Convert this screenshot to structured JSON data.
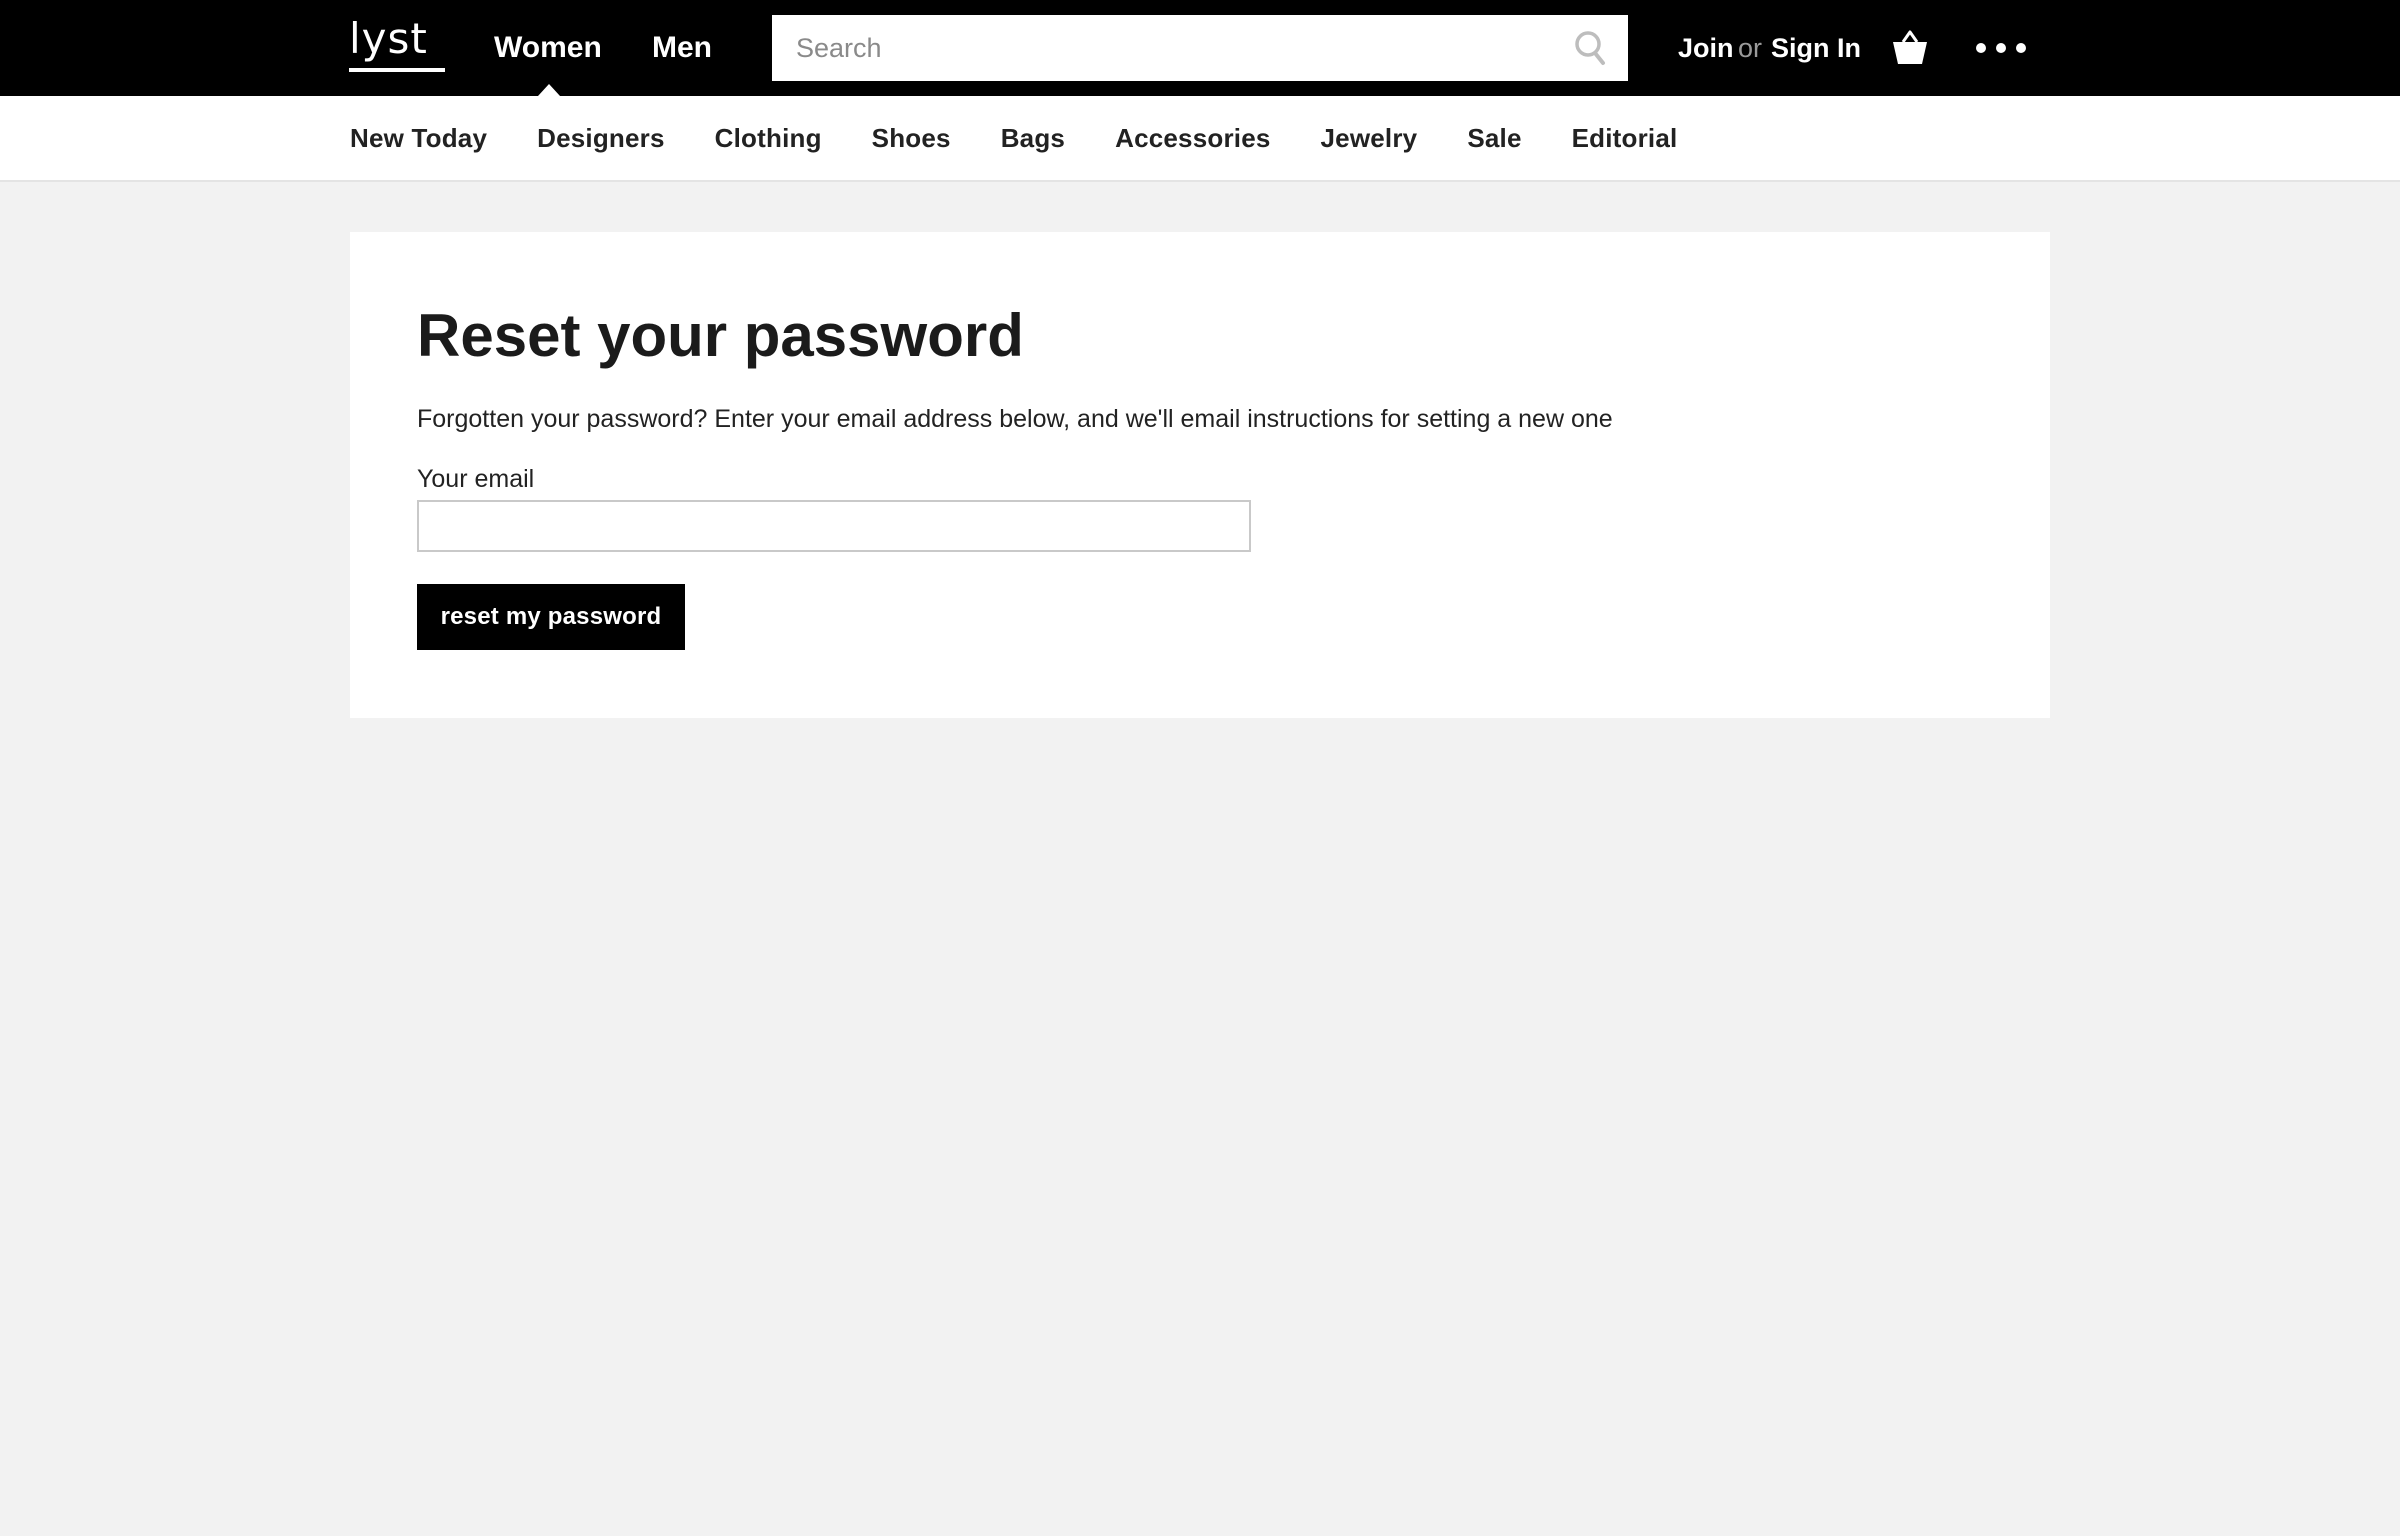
{
  "header": {
    "logo": "lyst",
    "tabs": [
      {
        "label": "Women",
        "active": true
      },
      {
        "label": "Men",
        "active": false
      }
    ],
    "search": {
      "placeholder": "Search",
      "value": "",
      "icon": "search-icon"
    },
    "auth": {
      "join_label": "Join",
      "or_label": "or",
      "signin_label": "Sign In"
    },
    "icons": {
      "bag": "shopping-bag-icon",
      "more": "more-dots-icon"
    }
  },
  "nav": {
    "items": [
      {
        "label": "New Today"
      },
      {
        "label": "Designers"
      },
      {
        "label": "Clothing"
      },
      {
        "label": "Shoes"
      },
      {
        "label": "Bags"
      },
      {
        "label": "Accessories"
      },
      {
        "label": "Jewelry"
      },
      {
        "label": "Sale"
      },
      {
        "label": "Editorial"
      }
    ]
  },
  "reset": {
    "title": "Reset your password",
    "description": "Forgotten your password? Enter your email address below, and we'll email instructions for setting a new one",
    "email_label": "Your email",
    "email_value": "",
    "button_label": "reset my password"
  },
  "colors": {
    "header_bg": "#000000",
    "page_bg": "#f2f2f2",
    "card_bg": "#ffffff",
    "button_bg": "#000000",
    "text": "#1b1b1b"
  }
}
